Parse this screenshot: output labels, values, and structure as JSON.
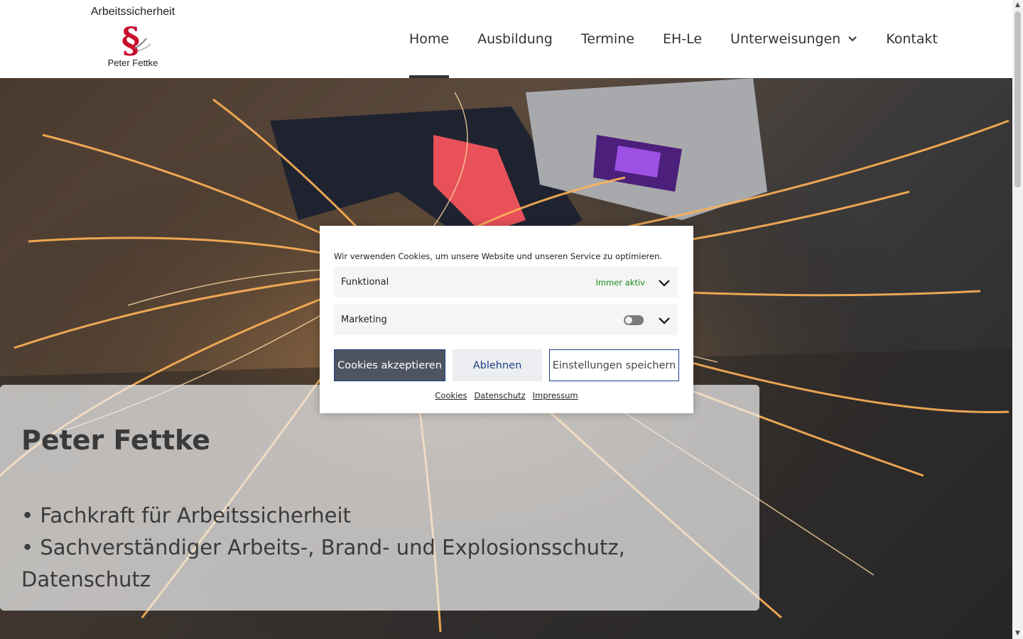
{
  "logo": {
    "top_text": "Arbeitssicherheit",
    "bottom_text": "Peter Fettke"
  },
  "nav": {
    "items": [
      {
        "label": "Home",
        "active": true
      },
      {
        "label": "Ausbildung"
      },
      {
        "label": "Termine"
      },
      {
        "label": "EH-Le"
      },
      {
        "label": "Unterweisungen",
        "has_dropdown": true
      },
      {
        "label": "Kontakt"
      }
    ]
  },
  "hero": {
    "title": "Peter Fettke",
    "line1": "• Fachkraft für Arbeitssicherheit",
    "line2": "• Sachverständiger Arbeits-, Brand- und Explosionsschutz,",
    "line3": "Datenschutz"
  },
  "cookie": {
    "message": "Wir verwenden Cookies, um unsere Website und unseren Service zu optimieren.",
    "rows": [
      {
        "label": "Funktional",
        "status": "Immer aktiv"
      },
      {
        "label": "Marketing",
        "enabled": false
      }
    ],
    "buttons": {
      "accept": "Cookies akzeptieren",
      "deny": "Ablehnen",
      "save": "Einstellungen speichern"
    },
    "links": [
      "Cookies",
      "Datenschutz",
      "Impressum"
    ]
  },
  "colors": {
    "accent_blue": "#1d3f85",
    "accept_bg": "#4e5561",
    "active_green": "#1a8a1a",
    "logo_red": "#c8102e"
  },
  "icons": [
    "section-sign-logo-icon",
    "chevron-down-icon",
    "toggle-switch",
    "scroll-arrow-up-icon",
    "scroll-arrow-down-icon"
  ]
}
